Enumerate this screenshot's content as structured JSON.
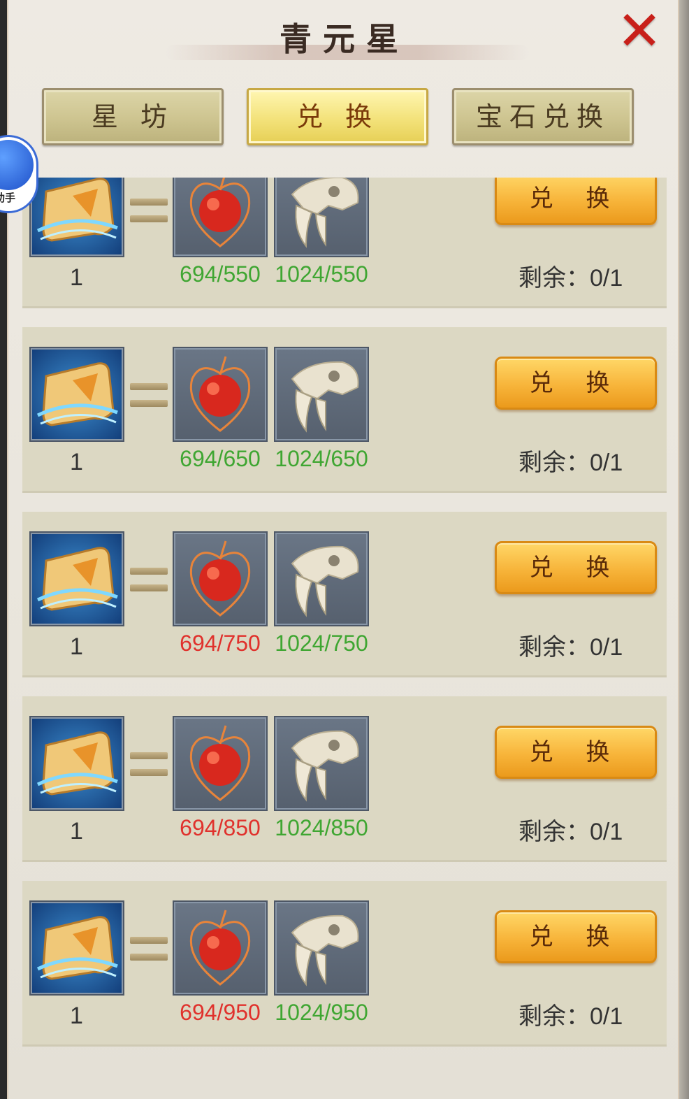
{
  "title": "青元星",
  "tabs": [
    {
      "label": "星 坊",
      "active": false
    },
    {
      "label": "兑 换",
      "active": true
    },
    {
      "label": "宝石兑换",
      "active": false
    }
  ],
  "assistant_badge": {
    "label": "助手"
  },
  "exchange_button_label": "兑 换",
  "remain_label": "剩余：",
  "items": [
    {
      "reward_count": "1",
      "cost_a": "694/550",
      "cost_a_ok": true,
      "cost_b": "1024/550",
      "remain": "0/1"
    },
    {
      "reward_count": "1",
      "cost_a": "694/650",
      "cost_a_ok": true,
      "cost_b": "1024/650",
      "remain": "0/1"
    },
    {
      "reward_count": "1",
      "cost_a": "694/750",
      "cost_a_ok": false,
      "cost_b": "1024/750",
      "remain": "0/1"
    },
    {
      "reward_count": "1",
      "cost_a": "694/850",
      "cost_a_ok": false,
      "cost_b": "1024/850",
      "remain": "0/1"
    },
    {
      "reward_count": "1",
      "cost_a": "694/950",
      "cost_a_ok": false,
      "cost_b": "1024/950",
      "remain": "0/1"
    }
  ],
  "icons": {
    "reward": "scroll-icon",
    "cost_a": "red-fruit-icon",
    "cost_b": "saber-skull-icon",
    "close": "close-icon"
  },
  "colors": {
    "ok": "#3fa632",
    "insufficient": "#e0312c",
    "button": "#f7b43a"
  }
}
